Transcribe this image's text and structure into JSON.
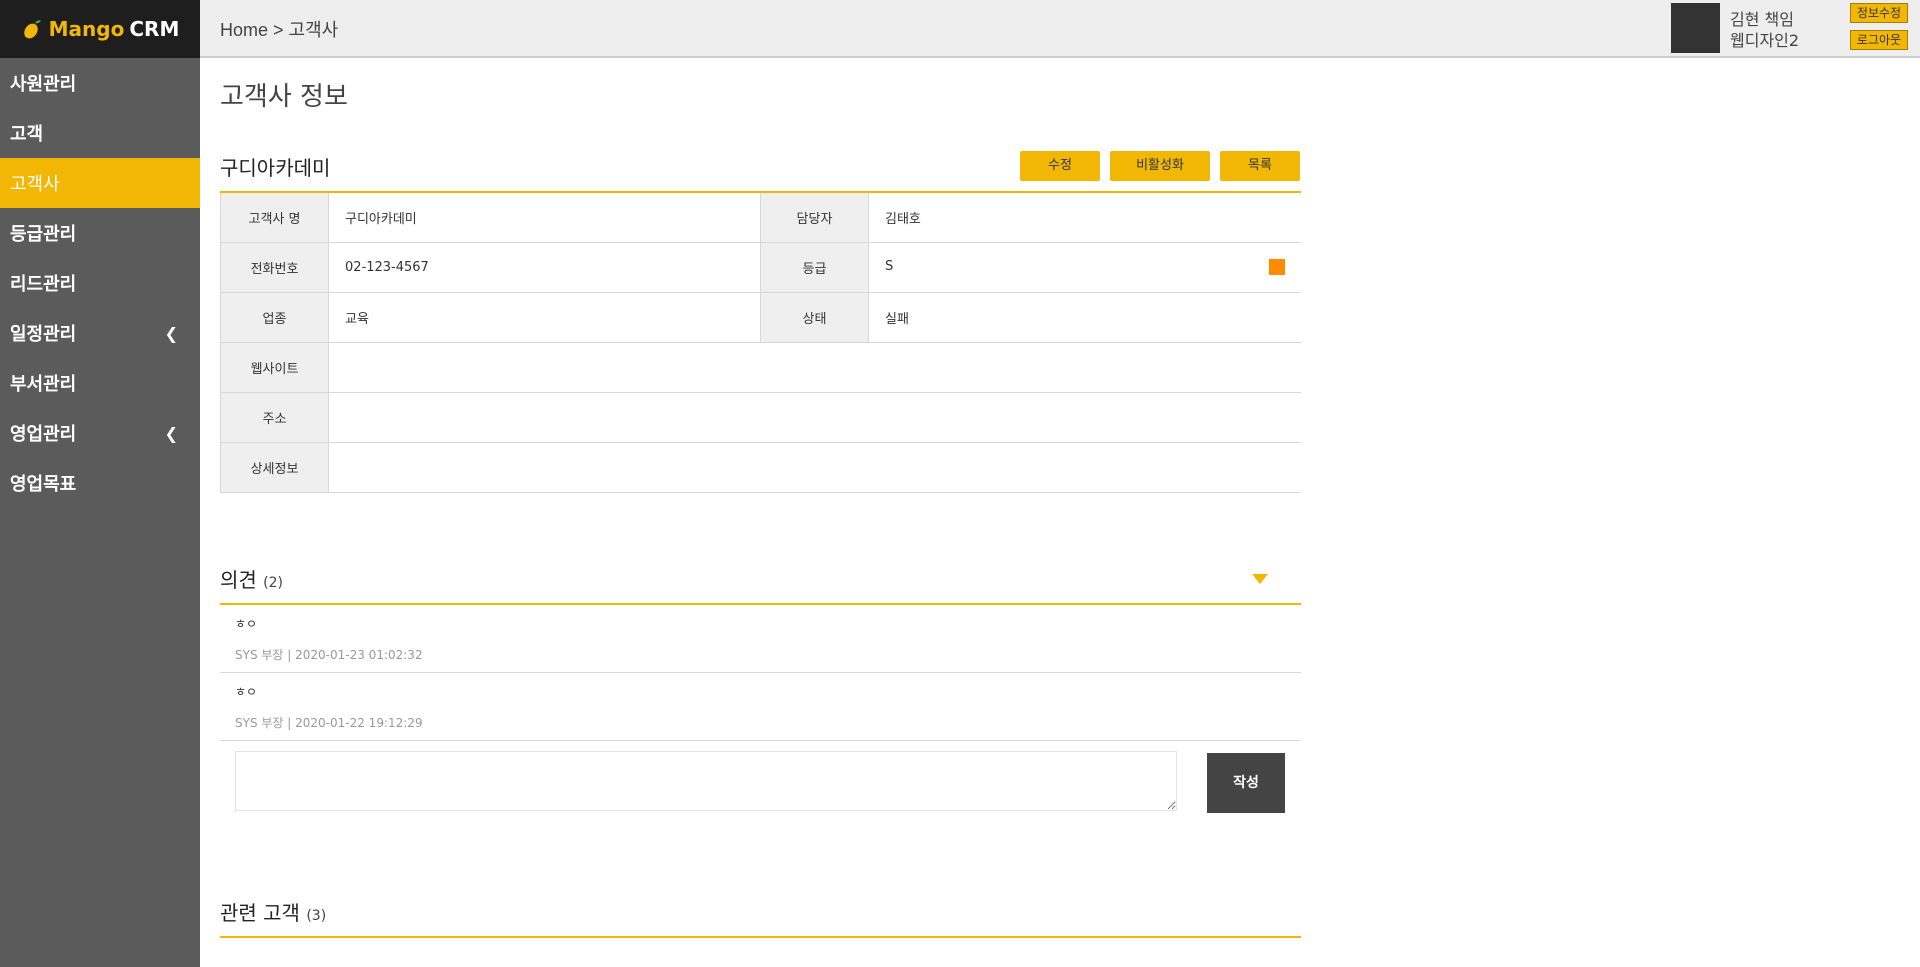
{
  "brand": {
    "name_part1": "Mango",
    "name_part2": "CRM",
    "accent": "#f2b705"
  },
  "sidebar": {
    "items": [
      {
        "label": "사원관리",
        "active": false,
        "has_submenu": false
      },
      {
        "label": "고객",
        "active": false,
        "has_submenu": false
      },
      {
        "label": "고객사",
        "active": true,
        "has_submenu": false
      },
      {
        "label": "등급관리",
        "active": false,
        "has_submenu": false
      },
      {
        "label": "리드관리",
        "active": false,
        "has_submenu": false
      },
      {
        "label": "일정관리",
        "active": false,
        "has_submenu": true
      },
      {
        "label": "부서관리",
        "active": false,
        "has_submenu": false
      },
      {
        "label": "영업관리",
        "active": false,
        "has_submenu": true
      },
      {
        "label": "영업목표",
        "active": false,
        "has_submenu": false
      }
    ],
    "submenu_icon": "chevron-left-icon"
  },
  "header": {
    "breadcrumb": "Home > 고객사",
    "user": {
      "name": "김현 책임",
      "team": "웹디자인2"
    },
    "edit_info_label": "정보수정",
    "logout_label": "로그아웃"
  },
  "main": {
    "page_title": "고객사 정보",
    "company_name": "구디아카데미",
    "actions": {
      "edit": "수정",
      "deactivate": "비활성화",
      "list": "목록"
    },
    "info": {
      "company_label": "고객사 명",
      "company_value": "구디아카데미",
      "manager_label": "담당자",
      "manager_value": "김태호",
      "phone_label": "전화번호",
      "phone_value": "02-123-4567",
      "grade_label": "등급",
      "grade_value": "S",
      "grade_color": "#ff8c00",
      "industry_label": "업종",
      "industry_value": "교육",
      "status_label": "상태",
      "status_value": "실패",
      "website_label": "웹사이트",
      "website_value": "",
      "address_label": "주소",
      "address_value": "",
      "detail_label": "상세정보",
      "detail_value": ""
    },
    "opinions": {
      "title": "의견",
      "count": "(2)",
      "items": [
        {
          "text": "ㅎㅇ",
          "meta": "SYS 부장 | 2020-01-23 01:02:32"
        },
        {
          "text": "ㅎㅇ",
          "meta": "SYS 부장 | 2020-01-22 19:12:29"
        }
      ],
      "input_value": "",
      "write_label": "작성"
    },
    "related": {
      "title": "관련 고객",
      "count": "(3)"
    }
  }
}
